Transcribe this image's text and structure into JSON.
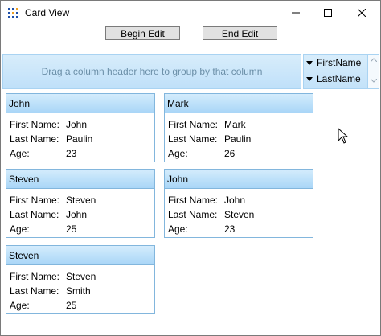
{
  "window": {
    "title": "Card View"
  },
  "toolbar": {
    "begin_edit_label": "Begin Edit",
    "end_edit_label": "End Edit"
  },
  "group_panel": {
    "hint": "Drag a column header here to group by that column"
  },
  "sort_panel": {
    "items": [
      {
        "label": "FirstName"
      },
      {
        "label": "LastName"
      }
    ]
  },
  "cards": [
    {
      "header": "John",
      "fields": [
        {
          "label": "First Name:",
          "value": "John"
        },
        {
          "label": "Last Name:",
          "value": "Paulin"
        },
        {
          "label": "Age:",
          "value": "23"
        }
      ]
    },
    {
      "header": "Mark",
      "fields": [
        {
          "label": "First Name:",
          "value": "Mark"
        },
        {
          "label": "Last Name:",
          "value": "Paulin"
        },
        {
          "label": "Age:",
          "value": "26"
        }
      ]
    },
    {
      "header": "Steven",
      "fields": [
        {
          "label": "First Name:",
          "value": "Steven"
        },
        {
          "label": "Last Name:",
          "value": "John"
        },
        {
          "label": "Age:",
          "value": "25"
        }
      ]
    },
    {
      "header": "John",
      "fields": [
        {
          "label": "First Name:",
          "value": "John"
        },
        {
          "label": "Last Name:",
          "value": "Steven"
        },
        {
          "label": "Age:",
          "value": "23"
        }
      ]
    },
    {
      "header": "Steven",
      "fields": [
        {
          "label": "First Name:",
          "value": "Steven"
        },
        {
          "label": "Last Name:",
          "value": "Smith"
        },
        {
          "label": "Age:",
          "value": "25"
        }
      ]
    }
  ],
  "colors": {
    "card_border": "#82b6dd",
    "header_top": "#d4ecfc",
    "header_bottom": "#a9d6f7",
    "panel": "#c8e5fa",
    "hint_text": "#6b8fa8"
  },
  "icons": {
    "app": "grid-app-icon",
    "minimize": "minimize-icon",
    "maximize": "maximize-icon",
    "close": "close-icon",
    "sort": "sort-descending-icon",
    "cursor": "mouse-pointer-icon"
  }
}
